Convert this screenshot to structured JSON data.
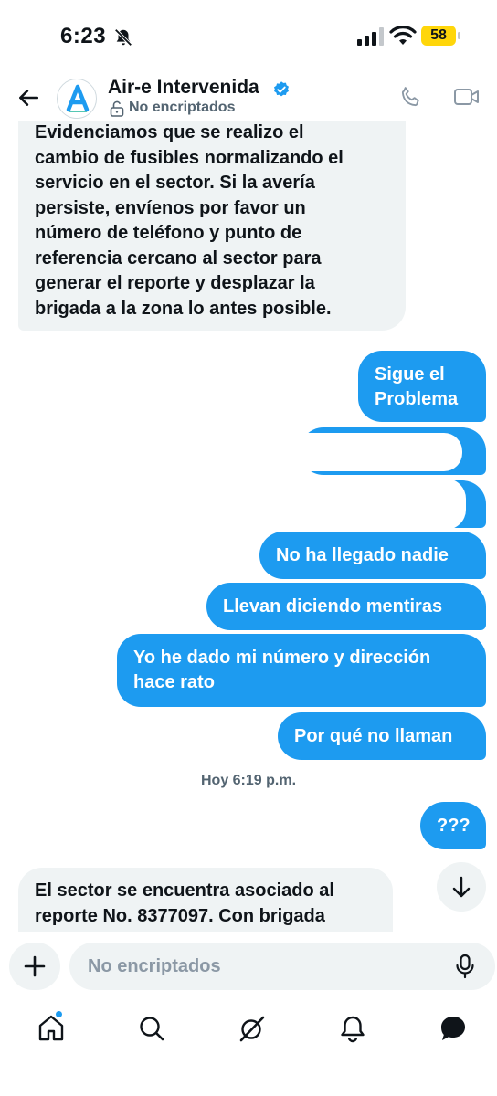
{
  "status_bar": {
    "time": "6:23",
    "battery": "58",
    "icons": [
      "bell-off-icon",
      "signal-icon",
      "wifi-icon",
      "battery-icon"
    ]
  },
  "header": {
    "contact_name": "Air-e Intervenida",
    "encryption_label": "No encriptados",
    "icons": [
      "back-arrow-icon",
      "verified-badge-icon",
      "lock-icon",
      "phone-call-icon",
      "video-call-icon"
    ]
  },
  "messages": [
    {
      "direction": "in",
      "lines": [
        "Evidenciamos que se realizo el",
        "cambio de fusibles normalizando el",
        "servicio en el sector. Si la avería",
        "persiste, envíenos por favor un",
        "número de teléfono y punto de",
        "referencia cercano al sector para",
        "generar el reporte y desplazar la",
        "brigada a la zona lo antes posible."
      ]
    },
    {
      "direction": "out",
      "lines": [
        "Sigue el",
        "Problema"
      ]
    },
    {
      "direction": "out",
      "redacted": true
    },
    {
      "direction": "out",
      "redacted": true
    },
    {
      "direction": "out",
      "text": "No ha llegado nadie"
    },
    {
      "direction": "out",
      "text": "Llevan diciendo mentiras"
    },
    {
      "direction": "out",
      "lines": [
        "Yo he dado mi número y dirección",
        "hace rato"
      ]
    },
    {
      "direction": "out",
      "text": "Por qué no llaman"
    },
    {
      "timestamp": "Hoy 6:19 p.m."
    },
    {
      "direction": "out",
      "text": "???"
    },
    {
      "direction": "in",
      "lines": [
        "El sector se encuentra asociado al",
        "reporte No. 8377097. Con brigada"
      ]
    }
  ],
  "composer": {
    "placeholder": "No encriptados",
    "icons": [
      "plus-icon",
      "microphone-icon",
      "scroll-down-arrow-icon"
    ]
  },
  "tabbar": {
    "items": [
      "home-icon",
      "search-icon",
      "grok-icon",
      "notifications-bell-icon",
      "messages-icon"
    ],
    "accent_color": "#1d9bf0"
  },
  "colors": {
    "accent": "#1d9bf0",
    "incoming_bubble": "#eff3f4",
    "secondary_text": "#536471"
  }
}
